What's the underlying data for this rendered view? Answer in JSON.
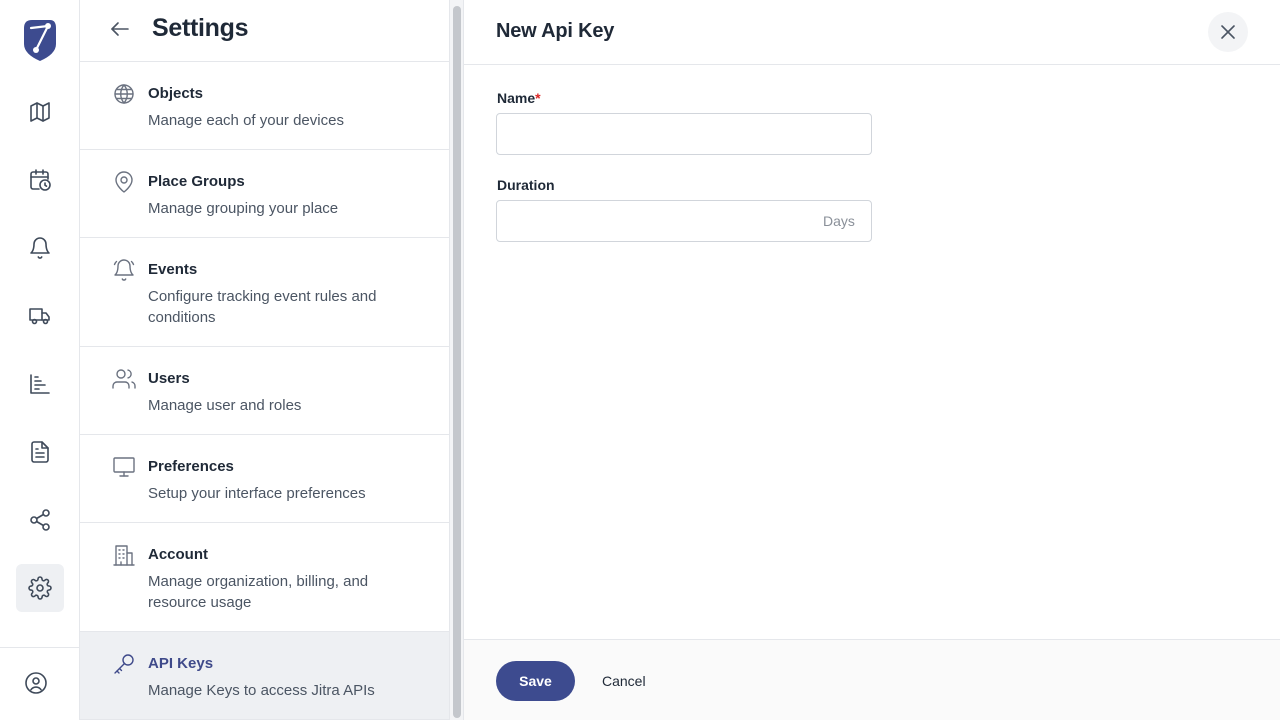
{
  "rail": {
    "logo": "jitra-logo",
    "items": [
      {
        "icon": "map-icon"
      },
      {
        "icon": "calendar-clock-icon"
      },
      {
        "icon": "bell-icon"
      },
      {
        "icon": "truck-icon"
      },
      {
        "icon": "bar-chart-icon"
      },
      {
        "icon": "document-icon"
      },
      {
        "icon": "share-icon"
      },
      {
        "icon": "gear-icon",
        "active": true
      }
    ],
    "bottom": {
      "icon": "user-circle-icon"
    }
  },
  "settings": {
    "title": "Settings",
    "items": [
      {
        "title": "Objects",
        "desc": "Manage each of your devices",
        "icon": "globe-icon"
      },
      {
        "title": "Place Groups",
        "desc": "Manage grouping your place",
        "icon": "map-pin-icon"
      },
      {
        "title": "Events",
        "desc": "Configure tracking event rules and conditions",
        "icon": "bell-icon"
      },
      {
        "title": "Users",
        "desc": "Manage user and roles",
        "icon": "users-icon"
      },
      {
        "title": "Preferences",
        "desc": "Setup your interface preferences",
        "icon": "monitor-icon"
      },
      {
        "title": "Account",
        "desc": "Manage organization, billing, and resource usage",
        "icon": "building-icon"
      },
      {
        "title": "API Keys",
        "desc": "Manage Keys to access Jitra APIs",
        "icon": "key-icon",
        "active": true
      }
    ]
  },
  "form": {
    "title": "New Api Key",
    "name_label": "Name",
    "required_mark": "*",
    "name_value": "",
    "duration_label": "Duration",
    "duration_value": "",
    "duration_suffix": "Days",
    "save_label": "Save",
    "cancel_label": "Cancel"
  },
  "colors": {
    "accent": "#3d4b8f",
    "active_bg": "#eef0f3",
    "required": "#dc2626"
  }
}
